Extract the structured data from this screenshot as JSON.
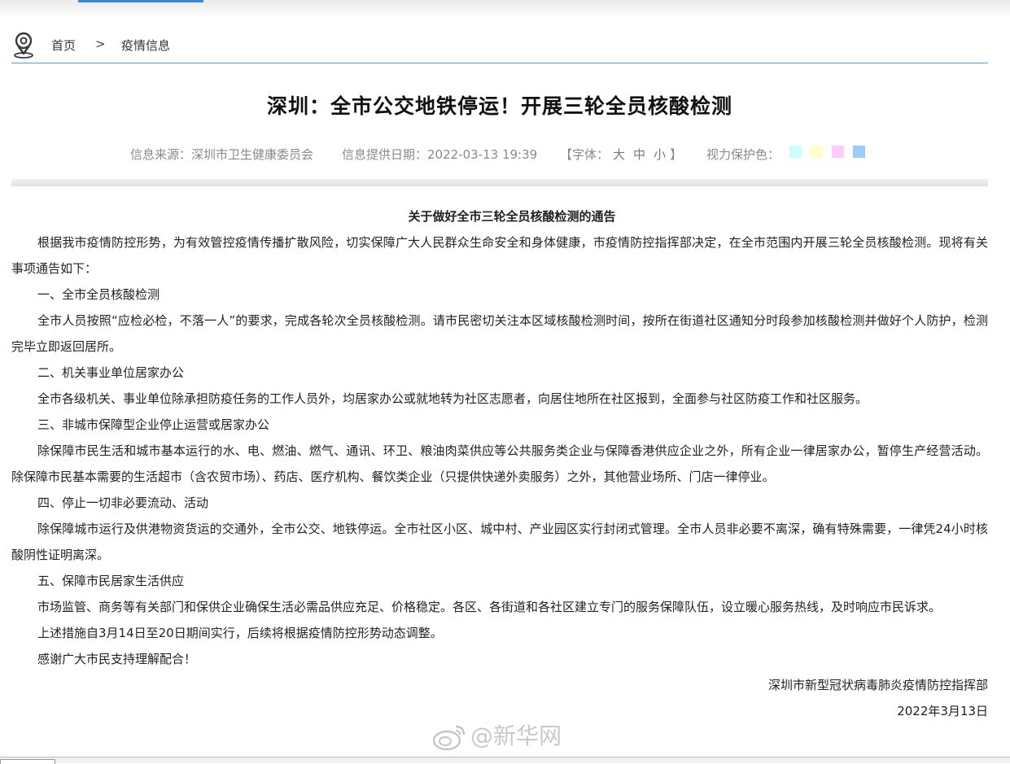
{
  "breadcrumb": {
    "home": "首页",
    "separator": ">",
    "current": "疫情信息"
  },
  "article": {
    "title": "深圳：全市公交地铁停运！开展三轮全员核酸检测",
    "meta": {
      "source": "信息来源：深圳市卫生健康委员会",
      "date": "信息提供日期：2022-03-13 19:39",
      "font_label": "【字体：",
      "font_large": "大",
      "font_medium": "中",
      "font_small": "小",
      "font_close": "】",
      "vision_label": "视力保护色："
    }
  },
  "eye_colors": [
    "#ccffff",
    "#ffffcc",
    "#ffccff",
    "#99ccff"
  ],
  "notice": {
    "title": "关于做好全市三轮全员核酸检测的通告",
    "paragraphs": [
      "根据我市疫情防控形势，为有效管控疫情传播扩散风险，切实保障广大人民群众生命安全和身体健康，市疫情防控指挥部决定，在全市范围内开展三轮全员核酸检测。现将有关事项通告如下：",
      "一、全市全员核酸检测",
      "全市人员按照“应检必检，不落一人”的要求，完成各轮次全员核酸检测。请市民密切关注本区域核酸检测时间，按所在街道社区通知分时段参加核酸检测并做好个人防护，检测完毕立即返回居所。",
      "二、机关事业单位居家办公",
      "全市各级机关、事业单位除承担防疫任务的工作人员外，均居家办公或就地转为社区志愿者，向居住地所在社区报到，全面参与社区防疫工作和社区服务。",
      "三、非城市保障型企业停止运营或居家办公",
      "除保障市民生活和城市基本运行的水、电、燃油、燃气、通讯、环卫、粮油肉菜供应等公共服务类企业与保障香港供应企业之外，所有企业一律居家办公，暂停生产经营活动。除保障市民基本需要的生活超市（含农贸市场）、药店、医疗机构、餐饮类企业（只提供快递外卖服务）之外，其他营业场所、门店一律停业。",
      "四、停止一切非必要流动、活动",
      "除保障城市运行及供港物资货运的交通外，全市公交、地铁停运。全市社区小区、城中村、产业园区实行封闭式管理。全市人员非必要不离深，确有特殊需要，一律凭24小时核酸阴性证明离深。",
      "五、保障市民居家生活供应",
      "市场监管、商务等有关部门和保供企业确保生活必需品供应充足、价格稳定。各区、各街道和各社区建立专门的服务保障队伍，设立暖心服务热线，及时响应市民诉求。",
      "上述措施自3月14日至20日期间实行，后续将根据疫情防控形势动态调整。",
      "感谢广大市民支持理解配合！"
    ],
    "signature": "深圳市新型冠状病毒肺炎疫情防控指挥部",
    "date": "2022年3月13日"
  },
  "watermark": {
    "text": "@新华网"
  }
}
